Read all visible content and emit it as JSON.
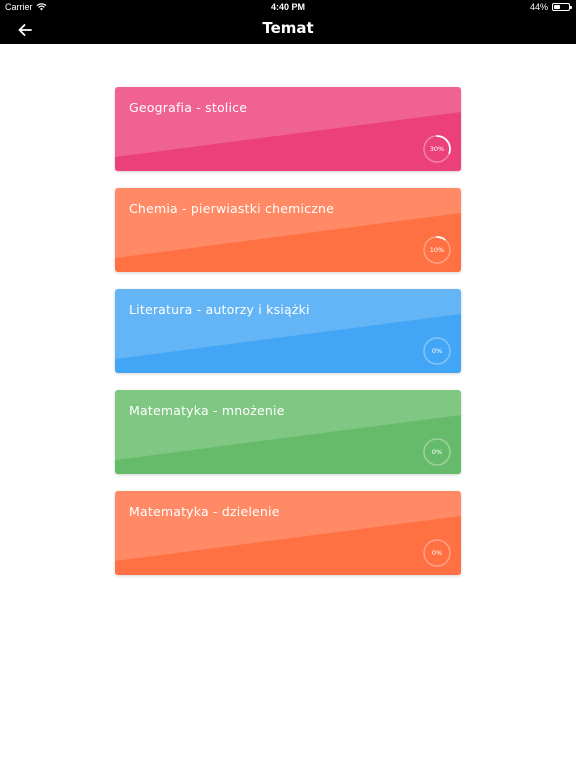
{
  "status_bar": {
    "carrier": "Carrier",
    "time": "4:40 PM",
    "battery": "44%",
    "battery_level": 0.44
  },
  "nav": {
    "title": "Temat",
    "back_icon": "arrow-left-icon"
  },
  "topics": [
    {
      "title": "Geografia - stolice",
      "progress_label": "30%",
      "progress": 0.3,
      "color_light": "#f06292",
      "color_dark": "#ec407a"
    },
    {
      "title": "Chemia - pierwiastki chemiczne",
      "progress_label": "10%",
      "progress": 0.1,
      "color_light": "#ff8a65",
      "color_dark": "#ff7043"
    },
    {
      "title": "Literatura - autorzy i książki",
      "progress_label": "0%",
      "progress": 0.0,
      "color_light": "#64b5f6",
      "color_dark": "#42a5f5"
    },
    {
      "title": "Matematyka - mnożenie",
      "progress_label": "0%",
      "progress": 0.0,
      "color_light": "#81c784",
      "color_dark": "#66bb6a"
    },
    {
      "title": "Matematyka - dzielenie",
      "progress_label": "0%",
      "progress": 0.0,
      "color_light": "#ff8a65",
      "color_dark": "#ff7043"
    }
  ]
}
